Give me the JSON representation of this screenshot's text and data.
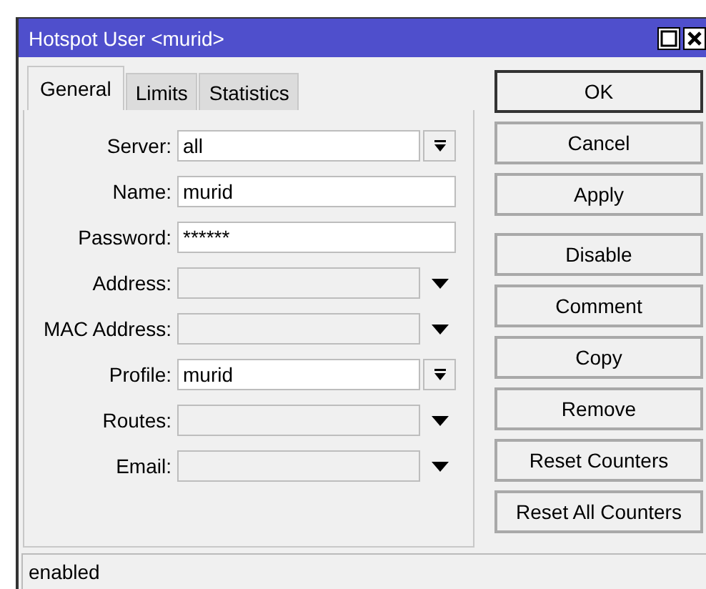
{
  "window": {
    "title": "Hotspot User <murid>"
  },
  "tabs": [
    {
      "label": "General",
      "selected": true
    },
    {
      "label": "Limits",
      "selected": false
    },
    {
      "label": "Statistics",
      "selected": false
    }
  ],
  "fields": [
    {
      "label": "Server:",
      "kind": "select",
      "value": "all"
    },
    {
      "label": "Name:",
      "kind": "text",
      "value": "murid"
    },
    {
      "label": "Password:",
      "kind": "text",
      "value": "******"
    },
    {
      "label": "Address:",
      "kind": "optional"
    },
    {
      "label": "MAC Address:",
      "kind": "optional"
    },
    {
      "label": "Profile:",
      "kind": "select",
      "value": "murid"
    },
    {
      "label": "Routes:",
      "kind": "optional"
    },
    {
      "label": "Email:",
      "kind": "optional"
    }
  ],
  "dialog_buttons": [
    {
      "label": "OK",
      "default": true
    },
    {
      "label": "Cancel",
      "default": false
    },
    {
      "label": "Apply",
      "default": false
    }
  ],
  "action_buttons": [
    {
      "label": "Disable"
    },
    {
      "label": "Comment"
    },
    {
      "label": "Copy"
    },
    {
      "label": "Remove"
    },
    {
      "label": "Reset Counters"
    },
    {
      "label": "Reset All Counters"
    }
  ],
  "status_bar": "enabled"
}
